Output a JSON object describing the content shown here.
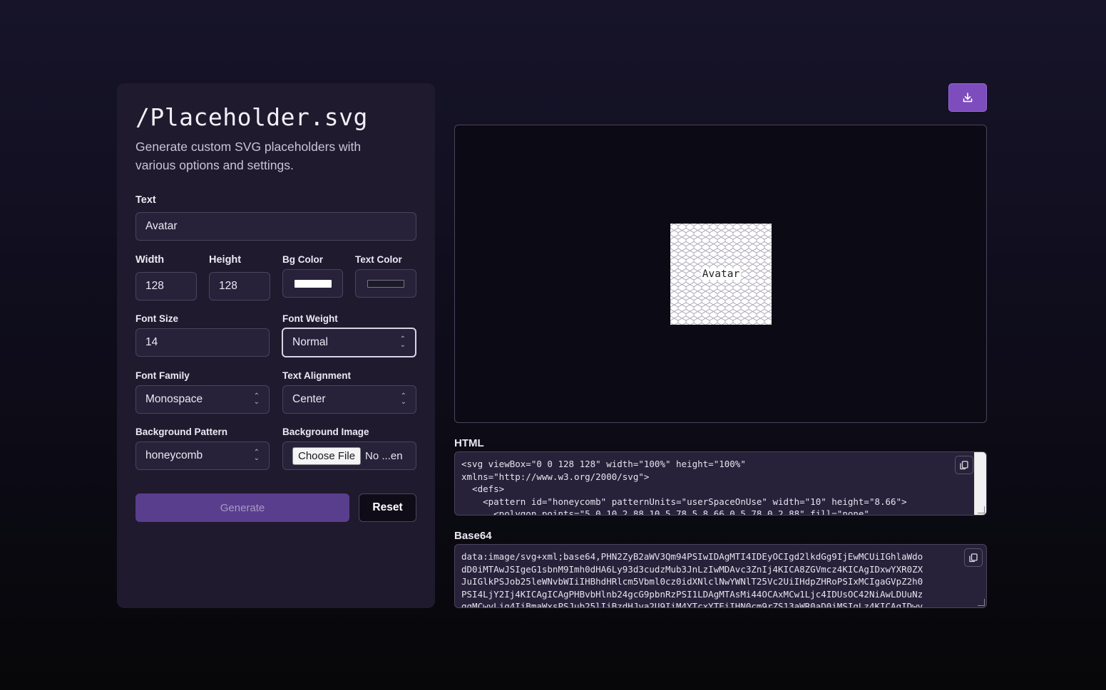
{
  "app": {
    "title": "/Placeholder.svg",
    "subtitle": "Generate custom SVG placeholders with various options and settings."
  },
  "form": {
    "text_label": "Text",
    "text_value": "Avatar",
    "width_label": "Width",
    "width_value": "128",
    "height_label": "Height",
    "height_value": "128",
    "bg_color_label": "Bg Color",
    "bg_color_value": "#ffffff",
    "text_color_label": "Text Color",
    "text_color_value": "#1c1a2a",
    "font_size_label": "Font Size",
    "font_size_value": "14",
    "font_weight_label": "Font Weight",
    "font_weight_value": "Normal",
    "font_family_label": "Font Family",
    "font_family_value": "Monospace",
    "text_alignment_label": "Text Alignment",
    "text_alignment_value": "Center",
    "bg_pattern_label": "Background Pattern",
    "bg_pattern_value": "honeycomb",
    "bg_image_label": "Background Image",
    "choose_file_label": "Choose File",
    "file_name": "No ...en",
    "generate_label": "Generate",
    "reset_label": "Reset"
  },
  "preview": {
    "text": "Avatar"
  },
  "output": {
    "html_label": "HTML",
    "html_code": "<svg viewBox=\"0 0 128 128\" width=\"100%\" height=\"100%\"\nxmlns=\"http://www.w3.org/2000/svg\">\n  <defs>\n    <pattern id=\"honeycomb\" patternUnits=\"userSpaceOnUse\" width=\"10\" height=\"8.66\">\n      <polygon points=\"5,0 10,2.88 10,5.78 5,8.66 0,5.78 0,2.88\" fill=\"none\"",
    "base64_label": "Base64",
    "base64_code": "data:image/svg+xml;base64,PHN2ZyB2aWV3Qm94PSIwIDAgMTI4IDEyOCIgd2lkdGg9IjEwMCUiIGhlaWdo\ndD0iMTAwJSIgeG1sbnM9Imh0dHA6Ly93d3cudzMub3JnLzIwMDAvc3ZnIj4KICA8ZGVmcz4KICAgIDxwYXR0ZX\nJuIGlkPSJob25leWNvbWIiIHBhdHRlcm5Vbml0cz0idXNlclNwYWNlT25Vc2UiIHdpZHRoPSIxMCIgaGVpZ2h0\nPSI4LjY2Ij4KICAgICAgPHBvbHlnb24gcG9pbnRzPSI1LDAgMTAsMi44OCAxMCw1Ljc4IDUsOC42NiAwLDUuNz\nggMCwyLjg4IiBmaWxsPSJub25lIiBzdHJva2U9IiM4YTcxYTEiIHN0cm9rZS13aWR0aD0iMSIgLz4KICAgIDwv"
  },
  "icons": {
    "download": "download-icon",
    "copy": "copy-icon",
    "chevron": "chevron-up-down-icon"
  },
  "colors": {
    "accent": "#7d4cbd",
    "generate_bg": "#5a3e8e",
    "panel_bg": "#1f1a2e"
  }
}
